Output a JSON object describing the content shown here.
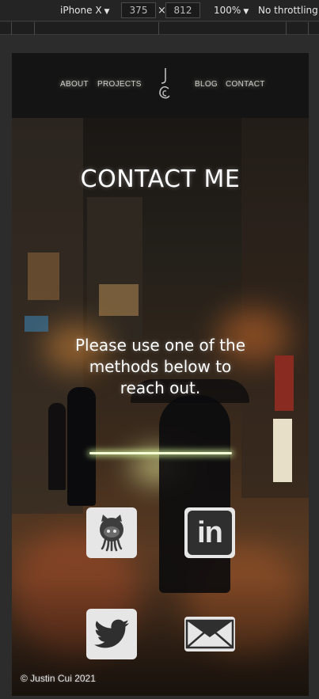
{
  "devtools": {
    "device": "iPhone X",
    "width": "375",
    "height": "812",
    "zoom": "100%",
    "throttling": "No throttling",
    "times": "×"
  },
  "nav": {
    "about": "ABOUT",
    "projects": "PROJECTS",
    "blog": "BLOG",
    "contact": "CONTACT"
  },
  "hero": {
    "title": "CONTACT ME",
    "subtitle_line1": "Please use one of the",
    "subtitle_line2": "methods below to",
    "subtitle_line3": "reach out."
  },
  "social": {
    "github_icon": "github-icon",
    "linkedin_icon": "linkedin-icon",
    "linkedin_text": "in",
    "twitter_icon": "twitter-icon",
    "mail_icon": "mail-icon"
  },
  "footer": {
    "copyright": "© Justin Cui 2021"
  },
  "colors": {
    "accent_glow": "#f4ffd8",
    "header_bg": "#141414",
    "icon_tile": "#e6e6e6"
  }
}
